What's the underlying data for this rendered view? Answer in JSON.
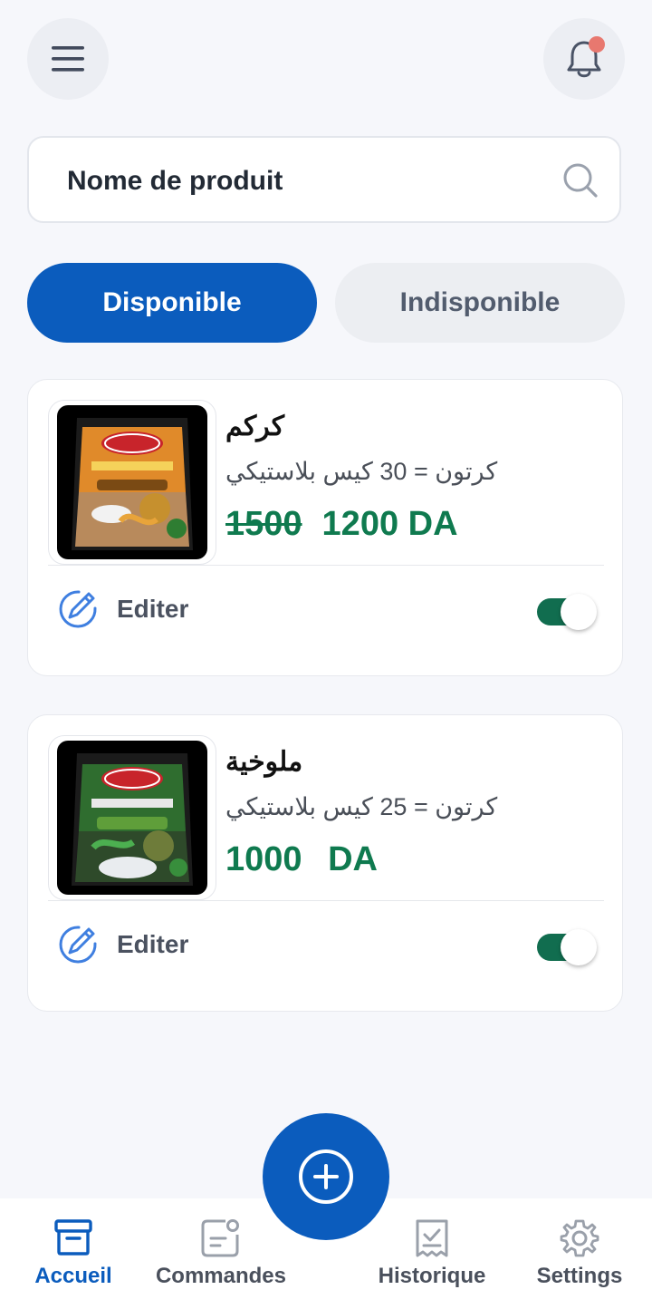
{
  "header": {
    "menu_icon": "hamburger-menu-icon",
    "bell_icon": "notification-bell-icon",
    "has_unread": true
  },
  "search": {
    "placeholder": "Nome de produit",
    "icon": "search-icon"
  },
  "tabs": [
    {
      "label": "Disponible",
      "active": true
    },
    {
      "label": "Indisponible",
      "active": false
    }
  ],
  "products": [
    {
      "name": "كركم",
      "description": "كرتون = 30 كيس بلاستيكي",
      "old_price": "1500",
      "price": "1200 DA",
      "edit_label": "Editer",
      "available": true
    },
    {
      "name": "ملوخية",
      "description": "كرتون = 25 كيس بلاستيكي",
      "price": "1000 DA",
      "edit_label": "Editer",
      "available": true
    }
  ],
  "fab": {
    "icon": "add-circle-icon"
  },
  "nav": [
    {
      "label": "Accueil",
      "icon": "archive-box-icon",
      "active": true
    },
    {
      "label": "Commandes",
      "icon": "orders-icon",
      "active": false
    },
    {
      "label": "Historique",
      "icon": "history-receipt-icon",
      "active": false
    },
    {
      "label": "Settings",
      "icon": "gear-icon",
      "active": false
    }
  ],
  "colors": {
    "primary": "#0b5cbd",
    "price": "#0f7a4f",
    "toggle_on": "#116d4f",
    "badge": "#e8786f"
  }
}
